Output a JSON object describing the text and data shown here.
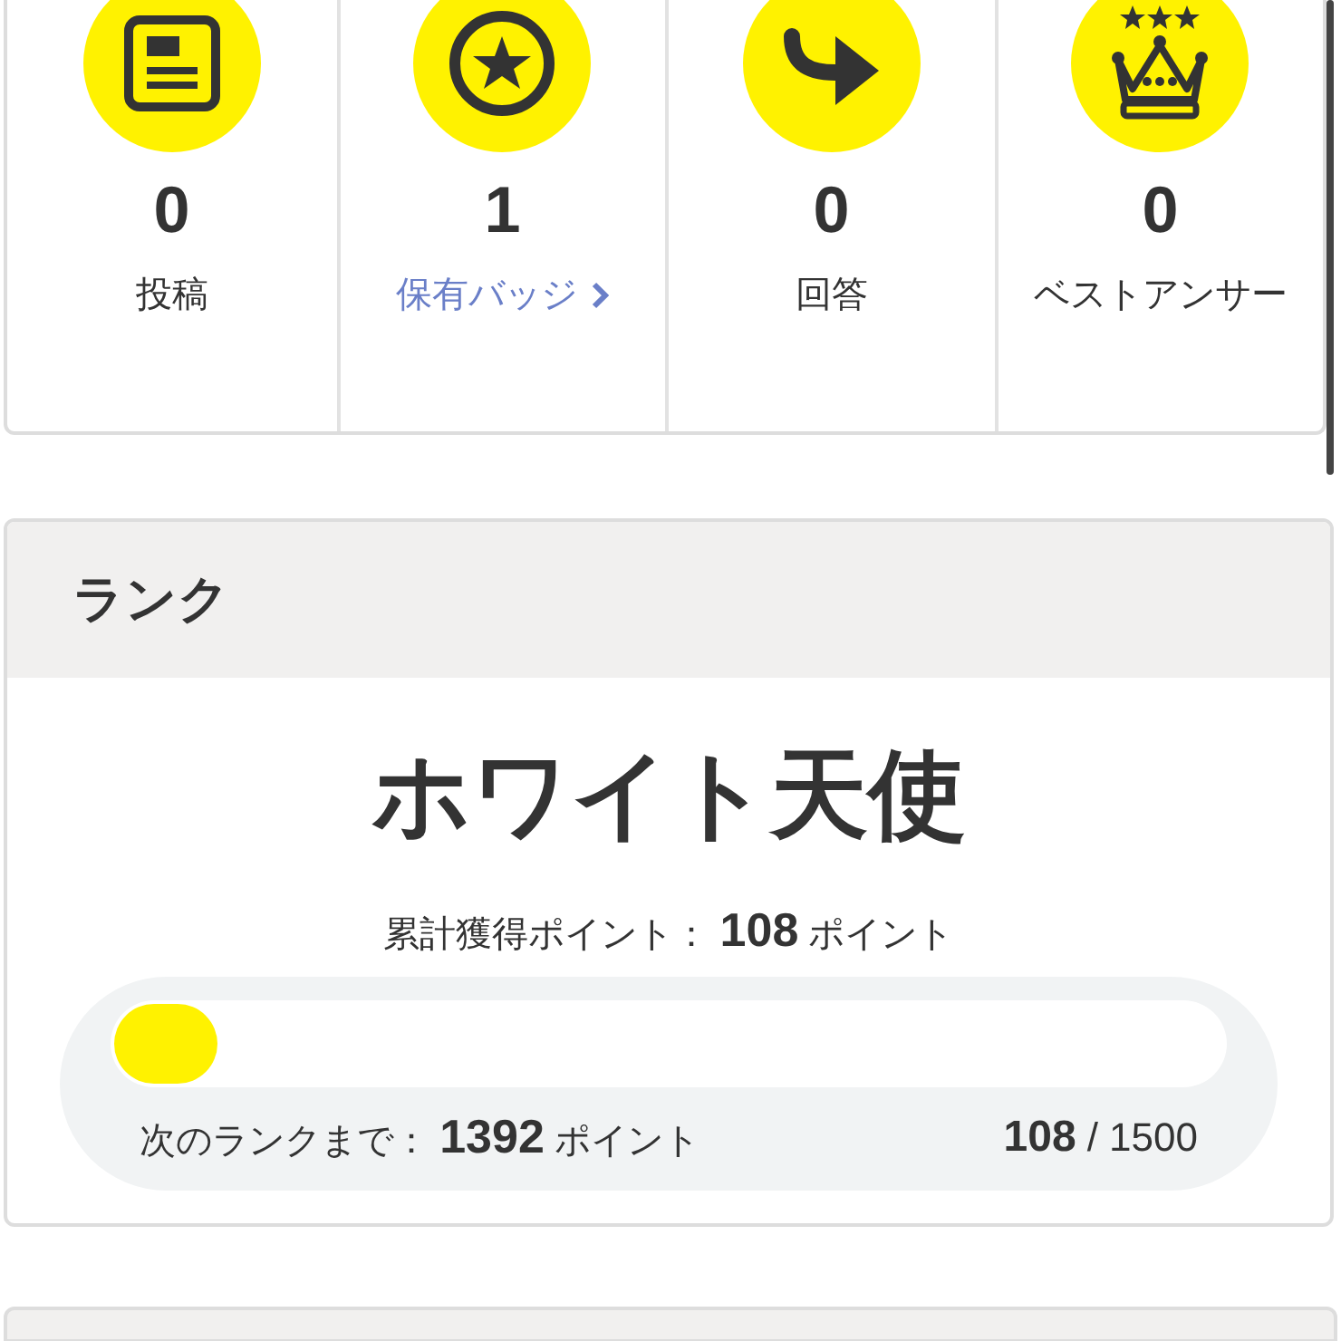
{
  "stats": [
    {
      "kind": "post",
      "count": "0",
      "label": "投稿",
      "link": false
    },
    {
      "kind": "badge",
      "count": "1",
      "label": "保有バッジ",
      "link": true
    },
    {
      "kind": "answer",
      "count": "0",
      "label": "回答",
      "link": false
    },
    {
      "kind": "best",
      "count": "0",
      "label": "ベストアンサー",
      "link": false
    }
  ],
  "rank": {
    "title": "ランク",
    "name": "ホワイト天使",
    "total": "累計獲得ポイント： **108** ポイント",
    "level": 0.072,
    "next": "次のランクまで： **1392** ポイント",
    "current": "108",
    "max": "/ 1500"
  }
}
